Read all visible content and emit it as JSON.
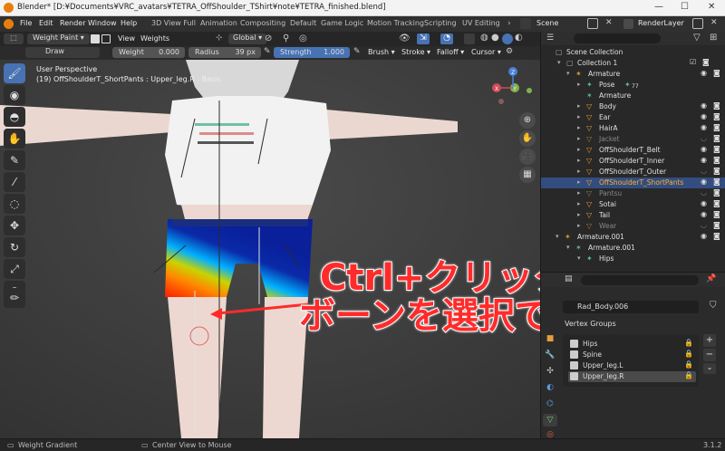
{
  "window": {
    "title": "Blender* [D:¥Documents¥VRC_avatars¥TETRA_OffShoulder_TShirt¥note¥TETRA_finished.blend]",
    "minimize": "—",
    "maximize": "☐",
    "close": "✕"
  },
  "menubar": {
    "menus": [
      "File",
      "Edit",
      "Render",
      "Window",
      "Help"
    ],
    "workspaces": [
      "3D View Full",
      "Animation",
      "Compositing",
      "Default",
      "Game Logic",
      "Motion Tracking",
      "Scripting",
      "UV Editing"
    ],
    "scene": "Scene",
    "view_layer": "RenderLayer"
  },
  "header": {
    "mode": "Weight Paint",
    "menus": [
      "View",
      "Weights"
    ],
    "transform_orientation": "Global"
  },
  "tool_settings": {
    "brush": "Draw",
    "weight": {
      "label": "Weight",
      "value": "0.000"
    },
    "radius": {
      "label": "Radius",
      "value": "39 px"
    },
    "strength": {
      "label": "Strength",
      "value": "1.000"
    },
    "menus": [
      "Brush",
      "Stroke",
      "Falloff",
      "Cursor"
    ]
  },
  "viewport": {
    "view_name": "User Perspective",
    "object_info": "(19) OffShoulderT_ShortPants : Upper_leg.R : Basis",
    "gizmo_axes": {
      "x": "X",
      "y": "Y",
      "z": "Z"
    }
  },
  "annotation": {
    "line1": "Ctrl+クリックで",
    "line2": "ボーンを選択できる",
    "color": "#ff2b2b"
  },
  "outliner": {
    "rows": [
      {
        "name": "Scene Collection",
        "level": 0
      },
      {
        "name": "Collection 1",
        "level": 1
      },
      {
        "name": "Armature",
        "level": 2
      },
      {
        "name": "Pose",
        "level": 3
      },
      {
        "name": "Armature",
        "level": 3
      },
      {
        "name": "Body",
        "level": 3
      },
      {
        "name": "Ear",
        "level": 3
      },
      {
        "name": "HairA",
        "level": 3
      },
      {
        "name": "Jacket",
        "level": 3
      },
      {
        "name": "OffShoulderT_Belt",
        "level": 3
      },
      {
        "name": "OffShoulderT_Inner",
        "level": 3
      },
      {
        "name": "OffShoulderT_Outer",
        "level": 3
      },
      {
        "name": "OffShoulderT_ShortPants",
        "level": 3
      },
      {
        "name": "Pantsu",
        "level": 3
      },
      {
        "name": "Sotai",
        "level": 3
      },
      {
        "name": "Tail",
        "level": 3
      },
      {
        "name": "Wear",
        "level": 3
      },
      {
        "name": "Armature.001",
        "level": 1
      },
      {
        "name": "Armature.001",
        "level": 2
      },
      {
        "name": "Hips",
        "level": 3
      }
    ],
    "pose_count": "77",
    "selected": "OffShoulderT_ShortPants"
  },
  "properties": {
    "mesh_name": "Rad_Body.006",
    "vertex_groups_title": "Vertex Groups",
    "vertex_groups": [
      "Hips",
      "Spine",
      "Upper_leg.L",
      "Upper_leg.R"
    ],
    "active_group": "Upper_leg.R"
  },
  "status": {
    "left": "Weight Gradient",
    "middle": "Center View to Mouse",
    "version": "3.1.2"
  }
}
